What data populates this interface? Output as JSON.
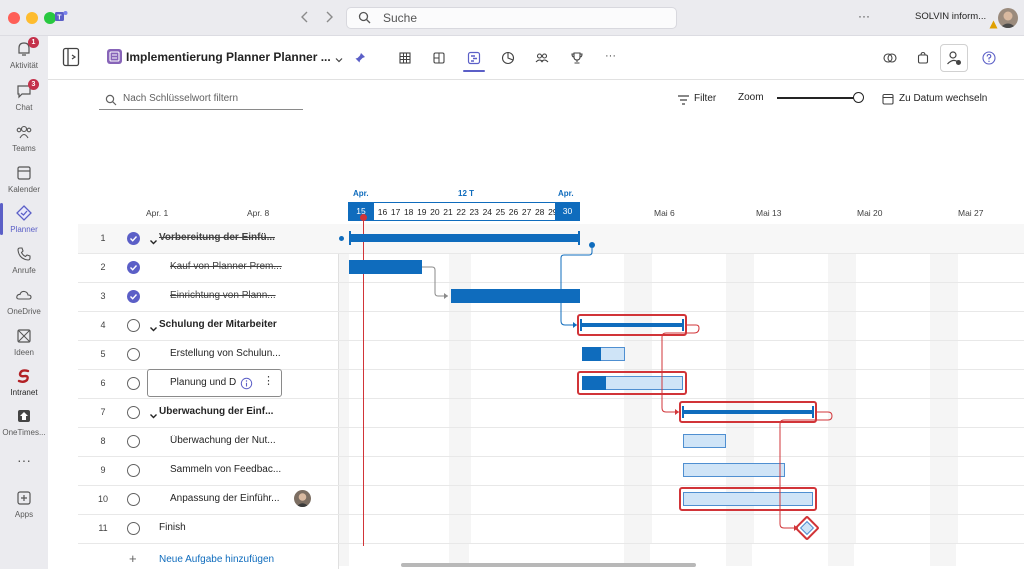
{
  "titlebar": {
    "search_placeholder": "Suche",
    "more": "···",
    "org_name": "SOLVIN inform..."
  },
  "rail": {
    "items": [
      {
        "label": "Aktivität",
        "badge": "1"
      },
      {
        "label": "Chat",
        "badge": "3"
      },
      {
        "label": "Teams"
      },
      {
        "label": "Kalender"
      },
      {
        "label": "Planner"
      },
      {
        "label": "Anrufe"
      },
      {
        "label": "OneDrive"
      },
      {
        "label": "Ideen"
      },
      {
        "label": "Intranet"
      },
      {
        "label": "OneTimes..."
      },
      {
        "label": "···"
      },
      {
        "label": "Apps"
      }
    ]
  },
  "header": {
    "plan_title": "Implementierung Planner Planner ...",
    "more": "···"
  },
  "toolbar": {
    "search_placeholder": "Nach Schlüsselwort filtern",
    "filter": "Filter",
    "zoom": "Zoom",
    "goto_date": "Zu Datum wechseln"
  },
  "timeline": {
    "top_labels": {
      "apr_left": "Apr.",
      "span": "12 T",
      "apr_right": "Apr."
    },
    "left_dates": [
      "Apr. 1",
      "Apr. 8"
    ],
    "days": [
      "15",
      "16",
      "17",
      "18",
      "19",
      "20",
      "21",
      "22",
      "23",
      "24",
      "25",
      "26",
      "27",
      "28",
      "29",
      "30"
    ],
    "right_dates": [
      "Mai 6",
      "Mai 13",
      "Mai 20",
      "Mai 27"
    ]
  },
  "tasks": [
    {
      "num": "1",
      "name": "Vorbereitung der Einfü...",
      "done": true,
      "summary": true
    },
    {
      "num": "2",
      "name": "Kauf von Planner Prem...",
      "done": true
    },
    {
      "num": "3",
      "name": "Einrichtung von Plann...",
      "done": true
    },
    {
      "num": "4",
      "name": "Schulung der Mitarbeiter",
      "done": false,
      "summary": true
    },
    {
      "num": "5",
      "name": "Erstellung von Schulun...",
      "done": false
    },
    {
      "num": "6",
      "name": "Planung und D",
      "done": false
    },
    {
      "num": "7",
      "name": "Überwachung der Einf...",
      "done": false,
      "summary": true
    },
    {
      "num": "8",
      "name": "Überwachung der Nut...",
      "done": false
    },
    {
      "num": "9",
      "name": "Sammeln von Feedbac...",
      "done": false
    },
    {
      "num": "10",
      "name": "Anpassung der Einführ...",
      "done": false
    },
    {
      "num": "11",
      "name": "Finish",
      "done": false
    }
  ],
  "add_task": "Neue Aufgabe hinzufügen",
  "progress": {
    "task5": 0.45,
    "task6": 0.24
  }
}
